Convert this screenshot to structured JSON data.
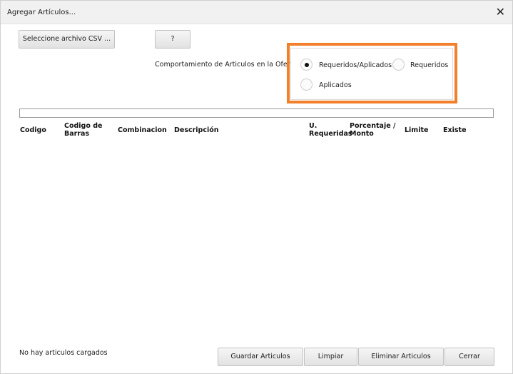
{
  "window": {
    "title": "Agregar Artículos...",
    "close_glyph": "✕"
  },
  "toolbar": {
    "select_csv_label": "Seleccione archivo CSV ...",
    "help_label": "?"
  },
  "behavior": {
    "label": "Comportamiento de Articulos en la Oferta",
    "options": [
      {
        "label": "Requeridos/Aplicados",
        "selected": true
      },
      {
        "label": "Requeridos",
        "selected": false
      },
      {
        "label": "Aplicados",
        "selected": false
      }
    ]
  },
  "table": {
    "columns": [
      {
        "line1": "Codigo",
        "line2": ""
      },
      {
        "line1": "Codigo de",
        "line2": "Barras"
      },
      {
        "line1": "Combinacion",
        "line2": ""
      },
      {
        "line1": "Descripción",
        "line2": ""
      },
      {
        "line1": "U.",
        "line2": "Requeridas"
      },
      {
        "line1": "Porcentaje /",
        "line2": "Monto"
      },
      {
        "line1": "Limite",
        "line2": ""
      },
      {
        "line1": "Existe",
        "line2": ""
      }
    ],
    "rows": []
  },
  "status": {
    "text": "No hay articulos cargados"
  },
  "footer": {
    "save_label": "Guardar Articulos",
    "clear_label": "Limpiar",
    "delete_label": "Eliminar Articulos",
    "close_label": "Cerrar"
  },
  "colors": {
    "highlight": "#f2802b"
  }
}
